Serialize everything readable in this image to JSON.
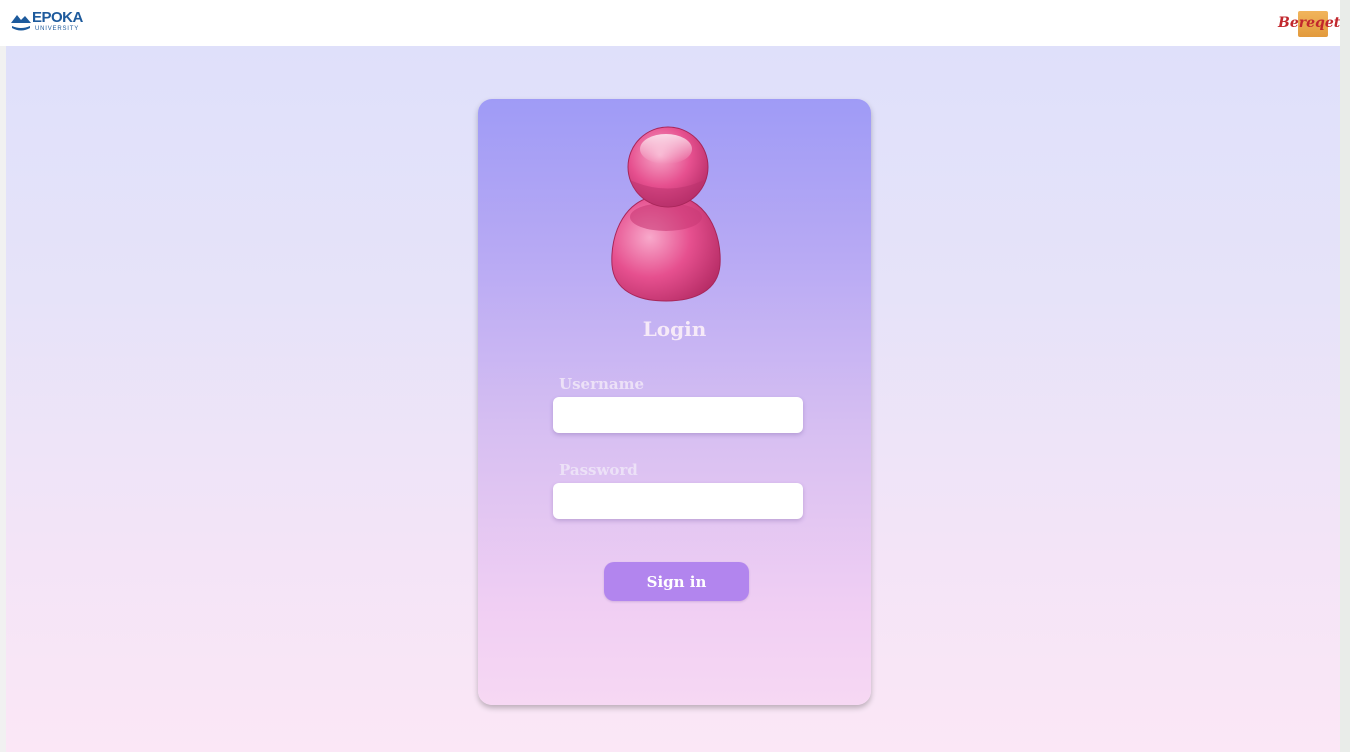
{
  "header": {
    "left_logo": {
      "name": "EPOKA",
      "subtitle": "UNIVERSITY",
      "color": "#1d5a9c"
    },
    "right_logo": {
      "name": "Bereqet",
      "color": "#c1272d"
    }
  },
  "login": {
    "title": "Login",
    "username_label": "Username",
    "username_value": "",
    "password_label": "Password",
    "password_value": "",
    "submit_label": "Sign in",
    "avatar_icon": "user-avatar-icon"
  },
  "colors": {
    "card_top": "#9f9bf6",
    "card_bottom": "#f6d8f3",
    "button": "#b285ee",
    "avatar": "#e14d8f",
    "page_background_top": "#dfe0fa",
    "page_background_bottom": "#fbe7f6"
  }
}
